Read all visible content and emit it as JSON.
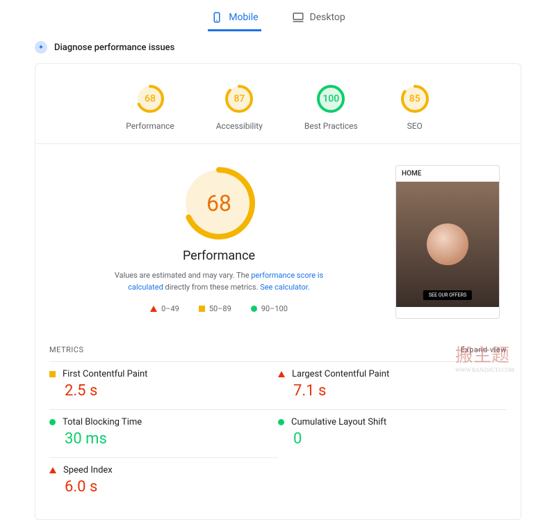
{
  "tabs": {
    "mobile": "Mobile",
    "desktop": "Desktop"
  },
  "diagnose": "Diagnose performance issues",
  "gauges": [
    {
      "score": 68,
      "label": "Performance",
      "color": "#f4b400",
      "bg": "#fdf2d7"
    },
    {
      "score": 87,
      "label": "Accessibility",
      "color": "#f4b400",
      "bg": "#fdf2d7"
    },
    {
      "score": 100,
      "label": "Best Practices",
      "color": "#0cce6b",
      "bg": "#e0f7e9"
    },
    {
      "score": 85,
      "label": "SEO",
      "color": "#f4b400",
      "bg": "#fdf2d7"
    }
  ],
  "perf": {
    "score": 68,
    "title": "Performance",
    "desc1": "Values are estimated and may vary. The ",
    "link1": "performance score is calculated",
    "desc2": " directly from these metrics. ",
    "link2": "See calculator."
  },
  "legend": {
    "r1": "0–49",
    "r2": "50–89",
    "r3": "90–100"
  },
  "preview": {
    "header": "HOME",
    "cta": "SEE OUR OFFERS"
  },
  "metricsHeader": {
    "title": "METRICS",
    "expand": "Expand view"
  },
  "metrics": [
    {
      "name": "First Contentful Paint",
      "value": "2.5 s",
      "status": "avg"
    },
    {
      "name": "Largest Contentful Paint",
      "value": "7.1 s",
      "status": "bad"
    },
    {
      "name": "Total Blocking Time",
      "value": "30 ms",
      "status": "good"
    },
    {
      "name": "Cumulative Layout Shift",
      "value": "0",
      "status": "good"
    },
    {
      "name": "Speed Index",
      "value": "6.0 s",
      "status": "bad"
    }
  ],
  "watermark": {
    "main": "搬主题",
    "sub": "WWW.BANZHUTI.COM"
  }
}
